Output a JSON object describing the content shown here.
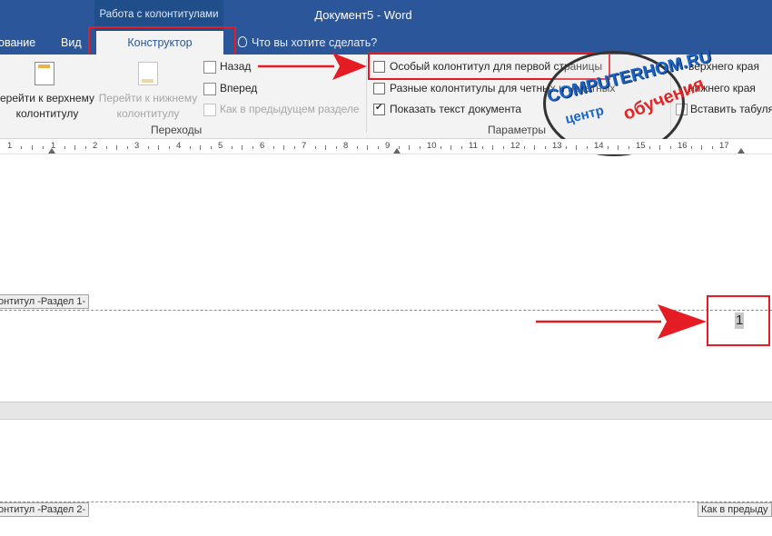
{
  "window": {
    "title": "Документ5 - Word",
    "context_group": "Работа с колонтитулами"
  },
  "tabs": {
    "partial_left": "ование",
    "view": "Вид",
    "constructor": "Конструктор",
    "tell_me": "Что вы хотите сделать?"
  },
  "ribbon": {
    "go_to_header": [
      "ерейти к верхнему",
      "колонтитулу"
    ],
    "go_to_footer": [
      "Перейти к нижнему",
      "колонтитулу"
    ],
    "back": "Назад",
    "forward": "Вперед",
    "link_previous": "Как в предыдущем разделе",
    "group_navigation": "Переходы",
    "option_first_page": "Особый колонтитул для первой страницы",
    "option_odd_even": "Разные колонтитулы для четных и нечетных",
    "option_show_text": "Показать текст документа",
    "group_options": "Параметры",
    "partial_header_from_top": "верхнего края",
    "partial_footer_from_bottom": "нижнего края",
    "insert_tab": "Вставить табуляцию",
    "options_checked": {
      "first_page": false,
      "odd_even": false,
      "show_text": true
    }
  },
  "ruler": {
    "numbers": [
      "1",
      "1",
      "2",
      "3",
      "4",
      "5",
      "6",
      "7",
      "8",
      "9",
      "10",
      "11",
      "12",
      "13",
      "14",
      "15",
      "16",
      "17"
    ]
  },
  "document": {
    "footer_section1": "онтитул -Раздел 1-",
    "page_number": "1",
    "footer_section2": "онтитул -Раздел 2-",
    "link_previous_tag": "Как в предыду"
  },
  "watermark": {
    "brand": "COMPUTERHOM.RU",
    "center": "центр",
    "learning": "обучения"
  },
  "colors": {
    "accent": "#2b579a",
    "annotation": "#e51c23"
  }
}
